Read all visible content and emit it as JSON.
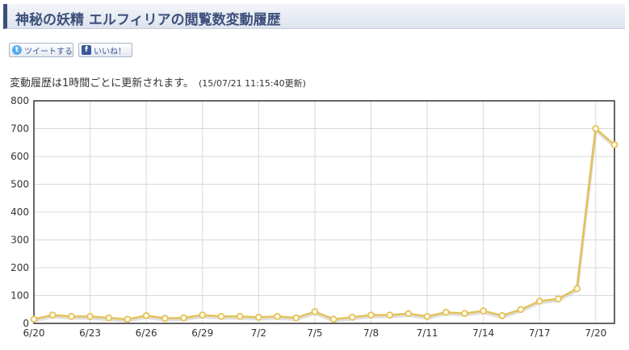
{
  "page": {
    "title": "神秘の妖精 エルフィリアの閲覧数変動履歴",
    "tweet_label": "ツイートする",
    "like_label": "いいね！",
    "note": "変動履歴は1時間ごとに更新されます。",
    "timestamp": "(15/07/21 11:15:40更新)"
  },
  "colors": {
    "accent": "#3c4f7a",
    "line": "#e3c25c",
    "marker_fill": "#fffbe6",
    "grid": "#d9d9d9"
  },
  "chart_data": {
    "type": "line",
    "x": [
      "6/20",
      "6/21",
      "6/22",
      "6/23",
      "6/24",
      "6/25",
      "6/26",
      "6/27",
      "6/28",
      "6/29",
      "6/30",
      "7/1",
      "7/2",
      "7/3",
      "7/4",
      "7/5",
      "7/6",
      "7/7",
      "7/8",
      "7/9",
      "7/10",
      "7/11",
      "7/12",
      "7/13",
      "7/14",
      "7/15",
      "7/16",
      "7/17",
      "7/18",
      "7/19",
      "7/20",
      "7/21"
    ],
    "xticks": [
      "6/20",
      "6/23",
      "6/26",
      "6/29",
      "7/2",
      "7/5",
      "7/8",
      "7/11",
      "7/14",
      "7/17",
      "7/20"
    ],
    "series": [
      {
        "values": [
          15,
          30,
          25,
          25,
          20,
          15,
          28,
          18,
          20,
          30,
          25,
          25,
          22,
          25,
          20,
          42,
          15,
          22,
          30,
          30,
          35,
          25,
          40,
          36,
          45,
          28,
          50,
          80,
          88,
          125,
          700,
          642
        ]
      }
    ],
    "yticks": [
      0,
      100,
      200,
      300,
      400,
      500,
      600,
      700,
      800
    ],
    "ylim": [
      0,
      800
    ],
    "grid": true,
    "title": "",
    "xlabel": "",
    "ylabel": ""
  }
}
